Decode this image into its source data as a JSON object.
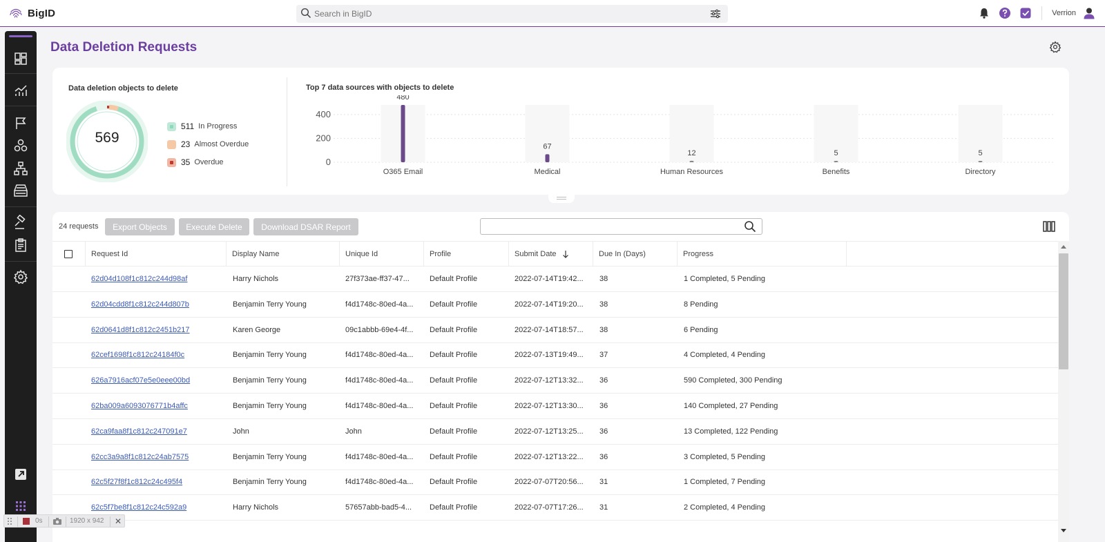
{
  "app": {
    "name": "BigID",
    "user": "Verrion"
  },
  "search": {
    "placeholder": "Search in BigID"
  },
  "page": {
    "title": "Data Deletion Requests"
  },
  "donut_chart": {
    "title": "Data deletion objects to delete",
    "total": "569",
    "legend": [
      {
        "count": "511",
        "label": "In Progress",
        "color": "#9fdcc2"
      },
      {
        "count": "23",
        "label": "Almost Overdue",
        "color": "#f5c9a6"
      },
      {
        "count": "35",
        "label": "Overdue",
        "color": "#c0392b"
      }
    ]
  },
  "bar_chart_title": "Top 7 data sources with objects to delete",
  "chart_data": {
    "type": "bar",
    "title": "Top 7 data sources with objects to delete",
    "categories": [
      "O365 Email",
      "Medical",
      "Human Resources",
      "Benefits",
      "Directory"
    ],
    "values": [
      480,
      67,
      12,
      5,
      5
    ],
    "yticks": [
      "400",
      "200",
      "0"
    ],
    "ylim": [
      0,
      480
    ],
    "bar_color": "#6b4a8a",
    "grid": true
  },
  "toolbar": {
    "count": "24 requests",
    "export": "Export Objects",
    "execute": "Execute Delete",
    "download": "Download DSAR Report"
  },
  "table": {
    "columns": [
      "Request Id",
      "Display Name",
      "Unique Id",
      "Profile",
      "Submit Date",
      "Due In (Days)",
      "Progress"
    ],
    "rows": [
      [
        "62d04d108f1c812c244d98af",
        "Harry Nichols",
        "27f373ae-ff37-47...",
        "Default Profile",
        "2022-07-14T19:42...",
        "38",
        "1 Completed, 5 Pending"
      ],
      [
        "62d04cdd8f1c812c244d807b",
        "Benjamin Terry Young",
        "f4d1748c-80ed-4a...",
        "Default Profile",
        "2022-07-14T19:20...",
        "38",
        "8 Pending"
      ],
      [
        "62d0641d8f1c812c2451b217",
        "Karen George",
        "09c1abbb-69e4-4f...",
        "Default Profile",
        "2022-07-14T18:57...",
        "38",
        "6 Pending"
      ],
      [
        "62cef1698f1c812c24184f0c",
        "Benjamin Terry Young",
        "f4d1748c-80ed-4a...",
        "Default Profile",
        "2022-07-13T19:49...",
        "37",
        "4 Completed, 4 Pending"
      ],
      [
        "626a7916acf07e5e0eee00bd",
        "Benjamin Terry Young",
        "f4d1748c-80ed-4a...",
        "Default Profile",
        "2022-07-12T13:32...",
        "36",
        "590 Completed, 300 Pending"
      ],
      [
        "62ba009a6093076771b4affc",
        "Benjamin Terry Young",
        "f4d1748c-80ed-4a...",
        "Default Profile",
        "2022-07-12T13:30...",
        "36",
        "140 Completed, 27 Pending"
      ],
      [
        "62ca9faa8f1c812c247091e7",
        "John",
        "John",
        "Default Profile",
        "2022-07-12T13:25...",
        "36",
        "13 Completed, 122 Pending"
      ],
      [
        "62cc3a9a8f1c812c24ab7575",
        "Benjamin Terry Young",
        "f4d1748c-80ed-4a...",
        "Default Profile",
        "2022-07-12T13:22...",
        "36",
        "3 Completed, 5 Pending"
      ],
      [
        "62c5f27f8f1c812c24c495f4",
        "Benjamin Terry Young",
        "f4d1748c-80ed-4a...",
        "Default Profile",
        "2022-07-07T20:56...",
        "31",
        "1 Completed, 7 Pending"
      ],
      [
        "62c5f7be8f1c812c24c592a9",
        "Harry Nichols",
        "57657abb-bad5-4...",
        "Default Profile",
        "2022-07-07T17:26...",
        "31",
        "2 Completed, 4 Pending"
      ]
    ]
  },
  "recorder": {
    "time": "0s",
    "size": "1920 x 942"
  }
}
